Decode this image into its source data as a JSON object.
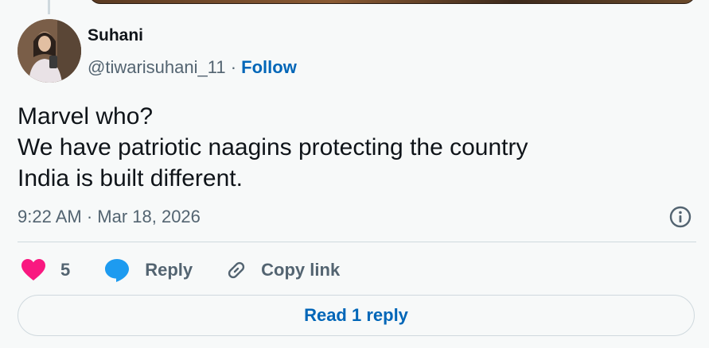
{
  "author": {
    "display_name": "Suhani",
    "handle": "@tiwarisuhani_11",
    "separator": "·",
    "follow_label": "Follow"
  },
  "tweet": {
    "lines": [
      "Marvel who?",
      "We have patriotic naagins protecting the country",
      "India is built different."
    ],
    "timestamp": "9:22 AM · Mar 18, 2026"
  },
  "actions": {
    "like_count": "5",
    "reply_label": "Reply",
    "copy_link_label": "Copy link"
  },
  "read_reply_label": "Read 1 reply",
  "icons": {
    "like": "heart-icon",
    "reply": "speech-bubble-icon",
    "copy_link": "link-icon",
    "info": "info-icon"
  },
  "colors": {
    "like": "#f91880",
    "reply_icon": "#1d9bf0",
    "link_text": "#0066b8",
    "secondary_text": "#536471"
  }
}
